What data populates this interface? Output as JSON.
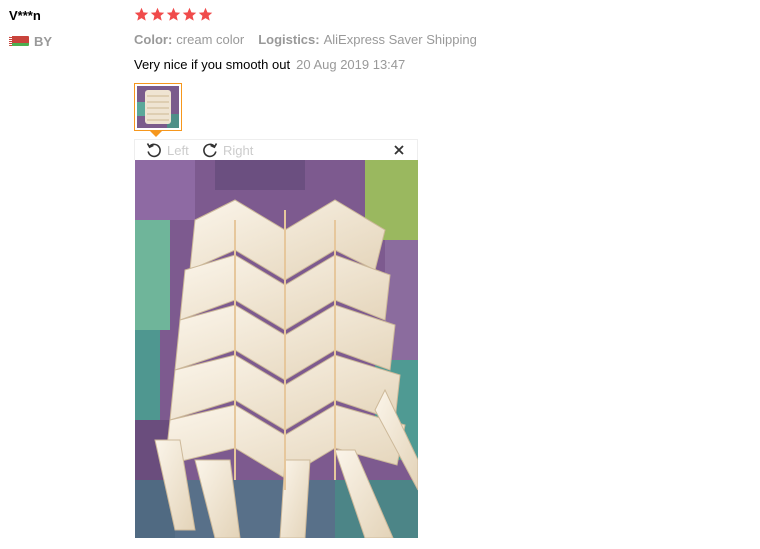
{
  "reviewer": {
    "name": "V***n",
    "country": "BY",
    "flag_colors": {
      "red": "#c9443c",
      "green": "#4caf50"
    }
  },
  "rating": {
    "stars": 5,
    "max": 5,
    "color": "#f04b4b"
  },
  "attributes": {
    "color_label": "Color:",
    "color_value": "cream color",
    "logistics_label": "Logistics:",
    "logistics_value": "AliExpress Saver Shipping"
  },
  "review": {
    "text": "Very nice if you smooth out",
    "date": "20 Aug 2019 13:47"
  },
  "viewer": {
    "rotate_left_label": "Left",
    "rotate_right_label": "Right",
    "rotate_left_icon": "rotate-left-icon",
    "rotate_right_icon": "rotate-right-icon",
    "close_icon": "close-icon",
    "accent": "#f6971d"
  }
}
